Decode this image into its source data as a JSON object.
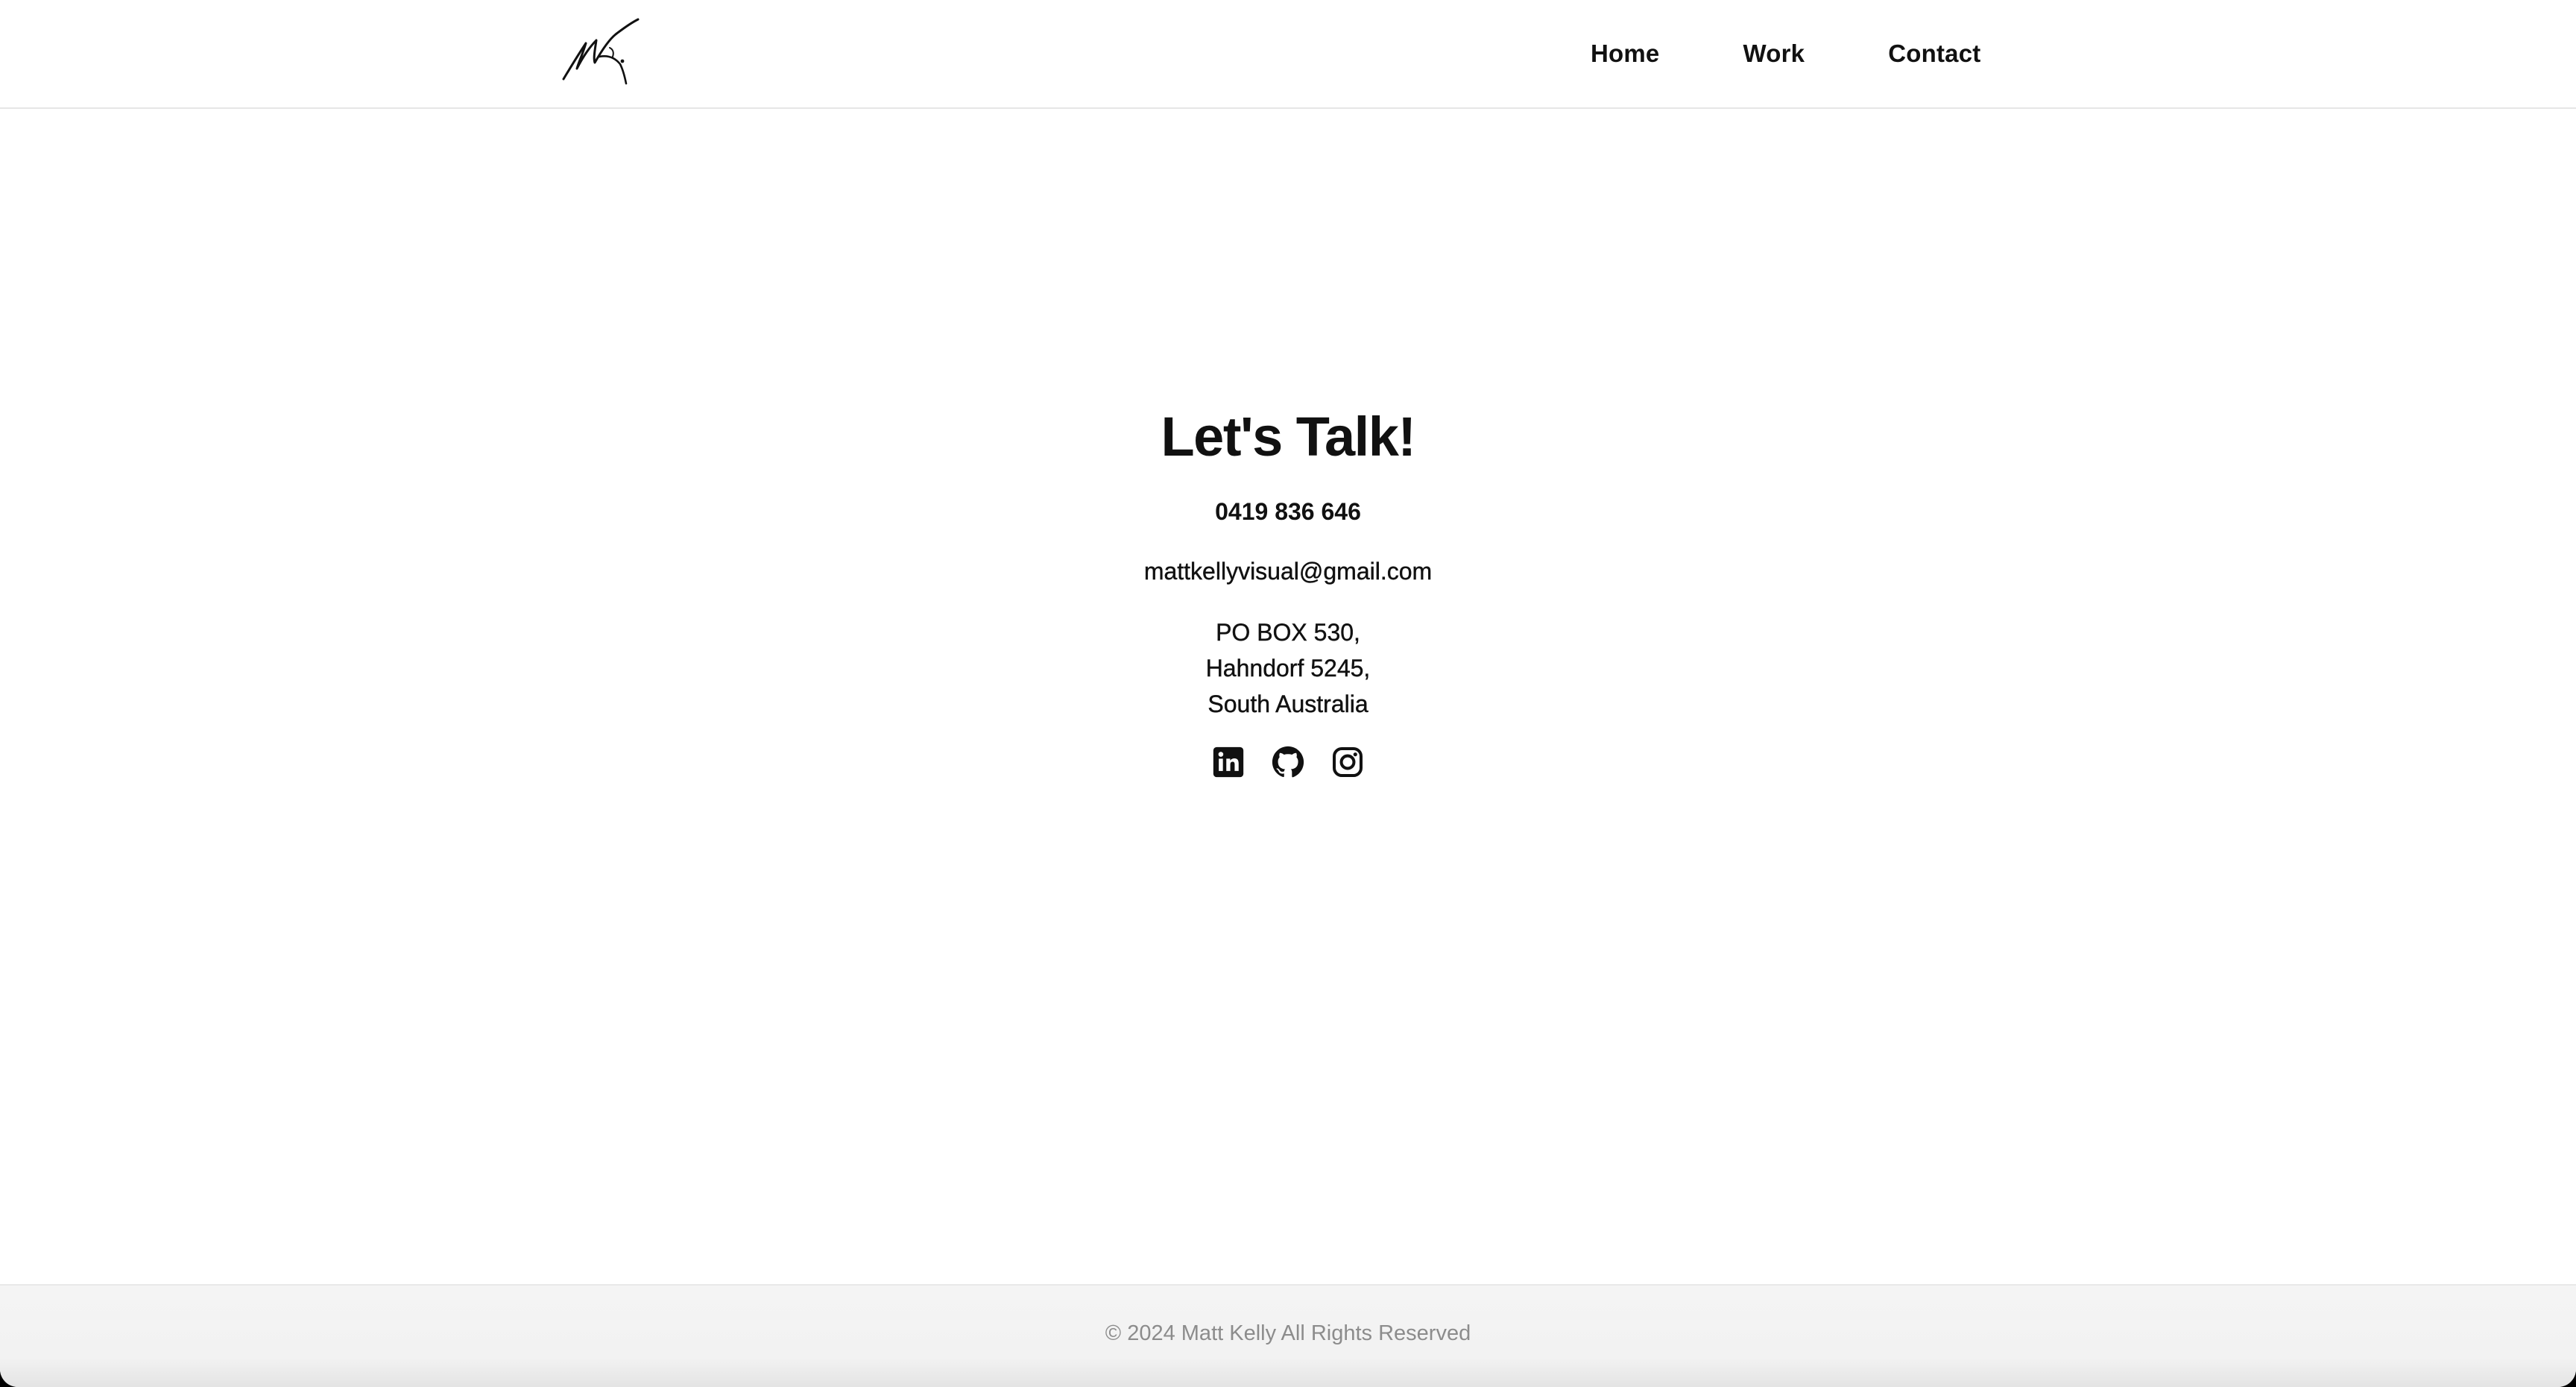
{
  "header": {
    "logo_alt": "MK",
    "nav": [
      {
        "label": "Home"
      },
      {
        "label": "Work"
      },
      {
        "label": "Contact"
      }
    ]
  },
  "contact": {
    "title": "Let's Talk!",
    "phone": "0419 836 646",
    "email": "mattkellyvisual@gmail.com",
    "address": [
      "PO BOX 530,",
      "Hahndorf 5245,",
      "South Australia"
    ],
    "socials": [
      {
        "icon": "linkedin-icon"
      },
      {
        "icon": "github-icon"
      },
      {
        "icon": "instagram-icon"
      }
    ]
  },
  "footer": {
    "copyright": "© 2024 Matt Kelly All Rights Reserved"
  },
  "colors": {
    "text": "#111111",
    "footer_text": "#8c8c8c",
    "footer_bg": "#f4f4f4",
    "header_border": "#e6e6e6"
  }
}
